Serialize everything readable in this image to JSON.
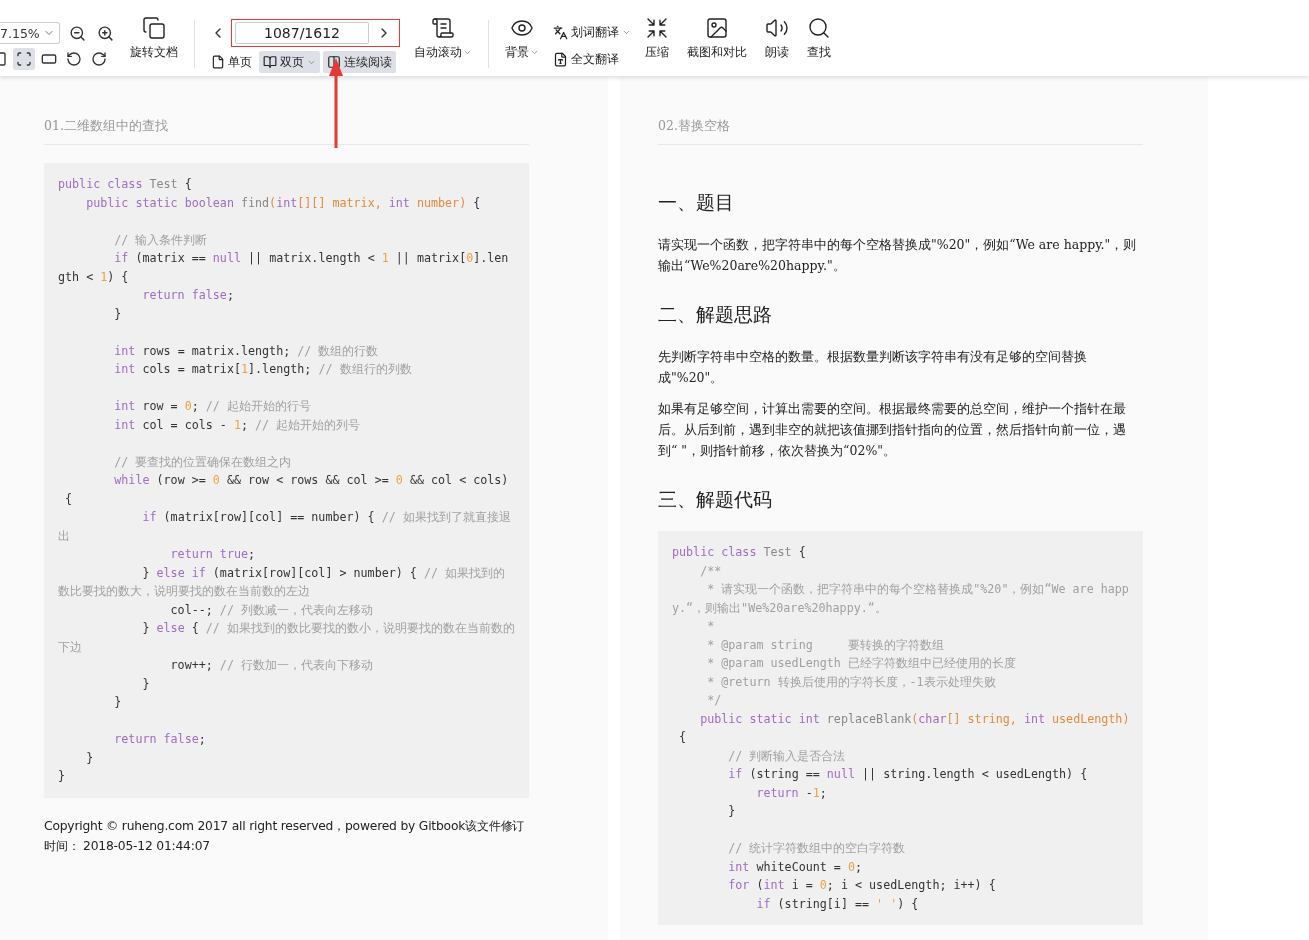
{
  "toolbar": {
    "zoom": "7.15%",
    "view_buttons": [
      {
        "kind": "partial",
        "selected": false
      },
      {
        "kind": "fit-page",
        "selected": true
      },
      {
        "kind": "fit-width",
        "selected": false
      },
      {
        "kind": "rotate-left",
        "selected": false
      },
      {
        "kind": "rotate-right",
        "selected": false
      }
    ],
    "rotate": {
      "label": "旋转文档"
    },
    "page_field": {
      "value": "1087/1612",
      "highlighted": true
    },
    "modes": [
      {
        "kind": "single",
        "label": "单页",
        "selected": false,
        "dropdown": false
      },
      {
        "kind": "double",
        "label": "双页",
        "selected": true,
        "dropdown": true
      },
      {
        "kind": "continuous",
        "label": "连续阅读",
        "selected": true,
        "dropdown": false
      }
    ],
    "auto_scroll": {
      "label": "自动滚动",
      "dropdown": true
    },
    "tools": [
      {
        "kind": "eye",
        "label": "背景",
        "dropdown": true
      },
      {
        "kind": "stack",
        "items": [
          {
            "kind": "word",
            "label": "划词翻译",
            "dropdown": true
          },
          {
            "kind": "full",
            "label": "全文翻译",
            "dropdown": false
          }
        ]
      },
      {
        "kind": "compress",
        "label": "压缩",
        "dropdown": false
      },
      {
        "kind": "screenshot",
        "label": "截图和对比",
        "dropdown": false
      },
      {
        "kind": "read",
        "label": "朗读",
        "dropdown": false
      },
      {
        "kind": "search",
        "label": "查找",
        "dropdown": false
      }
    ]
  },
  "pages": [
    {
      "title": "01.二维数组中的查找",
      "blocks": [
        {
          "kind": "code",
          "lines": [
            {
              "kind": "code",
              "segments": [
                {
                  "kind": "kw",
                  "text": "public class "
                },
                {
                  "kind": "name",
                  "text": "Test"
                },
                {
                  "kind": "plain",
                  "text": " {"
                }
              ]
            },
            {
              "kind": "code",
              "segments": [
                {
                  "kind": "kw",
                  "text": "    public static boolean "
                },
                {
                  "kind": "name",
                  "text": "find"
                },
                {
                  "kind": "param",
                  "text": "("
                },
                {
                  "kind": "kw",
                  "text": "int"
                },
                {
                  "kind": "param",
                  "text": "[][] matrix, "
                },
                {
                  "kind": "kw",
                  "text": "int "
                },
                {
                  "kind": "param",
                  "text": "number)"
                },
                {
                  "kind": "plain",
                  "text": " {"
                }
              ]
            },
            {
              "kind": "blank"
            },
            {
              "kind": "code",
              "segments": [
                {
                  "kind": "com",
                  "text": "        // 输入条件判断"
                }
              ]
            },
            {
              "kind": "code",
              "segments": [
                {
                  "kind": "kw",
                  "text": "        if"
                },
                {
                  "kind": "plain",
                  "text": " (matrix == "
                },
                {
                  "kind": "kw",
                  "text": "null"
                },
                {
                  "kind": "plain",
                  "text": " || matrix.length < "
                },
                {
                  "kind": "num",
                  "text": "1"
                },
                {
                  "kind": "plain",
                  "text": " || matrix["
                },
                {
                  "kind": "num",
                  "text": "0"
                },
                {
                  "kind": "plain",
                  "text": "].len"
                }
              ]
            },
            {
              "kind": "code",
              "segments": [
                {
                  "kind": "plain",
                  "text": "gth < "
                },
                {
                  "kind": "num",
                  "text": "1"
                },
                {
                  "kind": "plain",
                  "text": ") {"
                }
              ]
            },
            {
              "kind": "code",
              "segments": [
                {
                  "kind": "kw",
                  "text": "            return false"
                },
                {
                  "kind": "plain",
                  "text": ";"
                }
              ]
            },
            {
              "kind": "code",
              "segments": [
                {
                  "kind": "plain",
                  "text": "        }"
                }
              ]
            },
            {
              "kind": "blank"
            },
            {
              "kind": "code",
              "segments": [
                {
                  "kind": "kw",
                  "text": "        int"
                },
                {
                  "kind": "plain",
                  "text": " rows = matrix.length; "
                },
                {
                  "kind": "com",
                  "text": "// 数组的行数"
                }
              ]
            },
            {
              "kind": "code",
              "segments": [
                {
                  "kind": "kw",
                  "text": "        int"
                },
                {
                  "kind": "plain",
                  "text": " cols = matrix["
                },
                {
                  "kind": "num",
                  "text": "1"
                },
                {
                  "kind": "plain",
                  "text": "].length; "
                },
                {
                  "kind": "com",
                  "text": "// 数组行的列数"
                }
              ]
            },
            {
              "kind": "blank"
            },
            {
              "kind": "code",
              "segments": [
                {
                  "kind": "kw",
                  "text": "        int"
                },
                {
                  "kind": "plain",
                  "text": " row = "
                },
                {
                  "kind": "num",
                  "text": "0"
                },
                {
                  "kind": "plain",
                  "text": "; "
                },
                {
                  "kind": "com",
                  "text": "// 起始开始的行号"
                }
              ]
            },
            {
              "kind": "code",
              "segments": [
                {
                  "kind": "kw",
                  "text": "        int"
                },
                {
                  "kind": "plain",
                  "text": " col = cols - "
                },
                {
                  "kind": "num",
                  "text": "1"
                },
                {
                  "kind": "plain",
                  "text": "; "
                },
                {
                  "kind": "com",
                  "text": "// 起始开始的列号"
                }
              ]
            },
            {
              "kind": "blank"
            },
            {
              "kind": "code",
              "segments": [
                {
                  "kind": "com",
                  "text": "        // 要查找的位置确保在数组之内"
                }
              ]
            },
            {
              "kind": "code",
              "segments": [
                {
                  "kind": "kw",
                  "text": "        while"
                },
                {
                  "kind": "plain",
                  "text": " (row >= "
                },
                {
                  "kind": "num",
                  "text": "0"
                },
                {
                  "kind": "plain",
                  "text": " && row < rows && col >= "
                },
                {
                  "kind": "num",
                  "text": "0"
                },
                {
                  "kind": "plain",
                  "text": " && col < cols)"
                }
              ]
            },
            {
              "kind": "code",
              "segments": [
                {
                  "kind": "plain",
                  "text": " {"
                }
              ]
            },
            {
              "kind": "code",
              "segments": [
                {
                  "kind": "kw",
                  "text": "            if"
                },
                {
                  "kind": "plain",
                  "text": " (matrix[row][col] == number) { "
                },
                {
                  "kind": "com",
                  "text": "// 如果找到了就直接退"
                }
              ]
            },
            {
              "kind": "code",
              "segments": [
                {
                  "kind": "com",
                  "text": "出"
                }
              ]
            },
            {
              "kind": "code",
              "segments": [
                {
                  "kind": "kw",
                  "text": "                return true"
                },
                {
                  "kind": "plain",
                  "text": ";"
                }
              ]
            },
            {
              "kind": "code",
              "segments": [
                {
                  "kind": "plain",
                  "text": "            } "
                },
                {
                  "kind": "kw",
                  "text": "else if"
                },
                {
                  "kind": "plain",
                  "text": " (matrix[row][col] > number) { "
                },
                {
                  "kind": "com",
                  "text": "// 如果找到的"
                }
              ]
            },
            {
              "kind": "code",
              "segments": [
                {
                  "kind": "com",
                  "text": "数比要找的数大，说明要找的数在当前数的左边"
                }
              ]
            },
            {
              "kind": "code",
              "segments": [
                {
                  "kind": "plain",
                  "text": "                col--; "
                },
                {
                  "kind": "com",
                  "text": "// 列数减一，代表向左移动"
                }
              ]
            },
            {
              "kind": "code",
              "segments": [
                {
                  "kind": "plain",
                  "text": "            } "
                },
                {
                  "kind": "kw",
                  "text": "else"
                },
                {
                  "kind": "plain",
                  "text": " { "
                },
                {
                  "kind": "com",
                  "text": "// 如果找到的数比要找的数小，说明要找的数在当前数的"
                }
              ]
            },
            {
              "kind": "code",
              "segments": [
                {
                  "kind": "com",
                  "text": "下边"
                }
              ]
            },
            {
              "kind": "code",
              "segments": [
                {
                  "kind": "plain",
                  "text": "                row++; "
                },
                {
                  "kind": "com",
                  "text": "// 行数加一，代表向下移动"
                }
              ]
            },
            {
              "kind": "code",
              "segments": [
                {
                  "kind": "plain",
                  "text": "            }"
                }
              ]
            },
            {
              "kind": "code",
              "segments": [
                {
                  "kind": "plain",
                  "text": "        }"
                }
              ]
            },
            {
              "kind": "blank"
            },
            {
              "kind": "code",
              "segments": [
                {
                  "kind": "kw",
                  "text": "        return false"
                },
                {
                  "kind": "plain",
                  "text": ";"
                }
              ]
            },
            {
              "kind": "code",
              "segments": [
                {
                  "kind": "plain",
                  "text": "    }"
                }
              ]
            },
            {
              "kind": "code",
              "segments": [
                {
                  "kind": "plain",
                  "text": "}"
                }
              ]
            }
          ]
        },
        {
          "kind": "footer",
          "text": "Copyright © ruheng.com 2017 all right reserved，powered by Gitbook该文件修订时间： 2018-05-12 01:44:07"
        }
      ]
    },
    {
      "title": "02.替换空格",
      "blocks": [
        {
          "kind": "heading",
          "text": "一、题目"
        },
        {
          "kind": "para",
          "text": "请实现一个函数，把字符串中的每个空格替换成\"%20\"，例如“We are happy.\"，则输出“We%20are%20happy.\"。"
        },
        {
          "kind": "heading",
          "text": "二、解题思路"
        },
        {
          "kind": "para",
          "text": "先判断字符串中空格的数量。根据数量判断该字符串有没有足够的空间替换成\"%20\"。"
        },
        {
          "kind": "para",
          "text": "如果有足够空间，计算出需要的空间。根据最终需要的总空间，维护一个指针在最后。从后到前，遇到非空的就把该值挪到指针指向的位置，然后指针向前一位，遇到“ \"，则指针前移，依次替换为“02%\"。"
        },
        {
          "kind": "heading",
          "text": "三、解题代码"
        },
        {
          "kind": "code",
          "lines": [
            {
              "kind": "code",
              "segments": [
                {
                  "kind": "kw",
                  "text": "public class "
                },
                {
                  "kind": "name",
                  "text": "Test"
                },
                {
                  "kind": "plain",
                  "text": " {"
                }
              ]
            },
            {
              "kind": "code",
              "segments": [
                {
                  "kind": "com",
                  "text": "    /**"
                }
              ]
            },
            {
              "kind": "code",
              "segments": [
                {
                  "kind": "com",
                  "text": "     * 请实现一个函数，把字符串中的每个空格替换成\"%20\"，例如“We are happ"
                }
              ]
            },
            {
              "kind": "code",
              "segments": [
                {
                  "kind": "com",
                  "text": "y.“，则输出\"We%20are%20happy.“。"
                }
              ]
            },
            {
              "kind": "code",
              "segments": [
                {
                  "kind": "com",
                  "text": "     *"
                }
              ]
            },
            {
              "kind": "code",
              "segments": [
                {
                  "kind": "com",
                  "text": "     * @param string     要转换的字符数组"
                }
              ]
            },
            {
              "kind": "code",
              "segments": [
                {
                  "kind": "com",
                  "text": "     * @param usedLength 已经字符数组中已经使用的长度"
                }
              ]
            },
            {
              "kind": "code",
              "segments": [
                {
                  "kind": "com",
                  "text": "     * @return 转换后使用的字符长度，-1表示处理失败"
                }
              ]
            },
            {
              "kind": "code",
              "segments": [
                {
                  "kind": "com",
                  "text": "     */"
                }
              ]
            },
            {
              "kind": "code",
              "segments": [
                {
                  "kind": "kw",
                  "text": "    public static int "
                },
                {
                  "kind": "name",
                  "text": "replaceBlank"
                },
                {
                  "kind": "param",
                  "text": "("
                },
                {
                  "kind": "kw",
                  "text": "char"
                },
                {
                  "kind": "param",
                  "text": "[] string, "
                },
                {
                  "kind": "kw",
                  "text": "int "
                },
                {
                  "kind": "param",
                  "text": "usedLength)"
                }
              ]
            },
            {
              "kind": "code",
              "segments": [
                {
                  "kind": "plain",
                  "text": " {"
                }
              ]
            },
            {
              "kind": "code",
              "segments": [
                {
                  "kind": "com",
                  "text": "        // 判断输入是否合法"
                }
              ]
            },
            {
              "kind": "code",
              "segments": [
                {
                  "kind": "kw",
                  "text": "        if"
                },
                {
                  "kind": "plain",
                  "text": " (string == "
                },
                {
                  "kind": "kw",
                  "text": "null"
                },
                {
                  "kind": "plain",
                  "text": " || string.length < usedLength) {"
                }
              ]
            },
            {
              "kind": "code",
              "segments": [
                {
                  "kind": "kw",
                  "text": "            return"
                },
                {
                  "kind": "plain",
                  "text": " -"
                },
                {
                  "kind": "num",
                  "text": "1"
                },
                {
                  "kind": "plain",
                  "text": ";"
                }
              ]
            },
            {
              "kind": "code",
              "segments": [
                {
                  "kind": "plain",
                  "text": "        }"
                }
              ]
            },
            {
              "kind": "blank"
            },
            {
              "kind": "code",
              "segments": [
                {
                  "kind": "com",
                  "text": "        // 统计字符数组中的空白字符数"
                }
              ]
            },
            {
              "kind": "code",
              "segments": [
                {
                  "kind": "kw",
                  "text": "        int"
                },
                {
                  "kind": "plain",
                  "text": " whiteCount = "
                },
                {
                  "kind": "num",
                  "text": "0"
                },
                {
                  "kind": "plain",
                  "text": ";"
                }
              ]
            },
            {
              "kind": "code",
              "segments": [
                {
                  "kind": "kw",
                  "text": "        for"
                },
                {
                  "kind": "plain",
                  "text": " ("
                },
                {
                  "kind": "kw",
                  "text": "int"
                },
                {
                  "kind": "plain",
                  "text": " i = "
                },
                {
                  "kind": "num",
                  "text": "0"
                },
                {
                  "kind": "plain",
                  "text": "; i < usedLength; i++) {"
                }
              ]
            },
            {
              "kind": "code",
              "segments": [
                {
                  "kind": "kw",
                  "text": "            if"
                },
                {
                  "kind": "plain",
                  "text": " (string[i] == "
                },
                {
                  "kind": "num",
                  "text": "' '"
                },
                {
                  "kind": "plain",
                  "text": ") {"
                }
              ]
            }
          ]
        }
      ]
    }
  ]
}
